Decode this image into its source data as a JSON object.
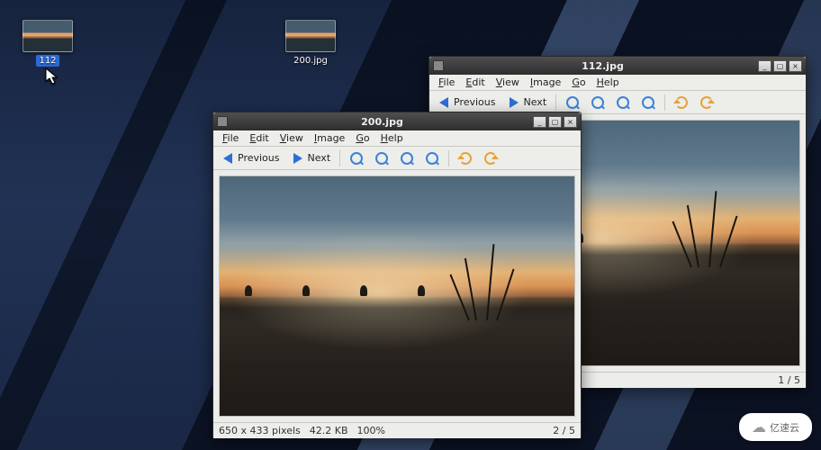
{
  "desktop": {
    "icons": [
      {
        "label": "112",
        "selected": true
      },
      {
        "label": "200.jpg",
        "selected": false
      }
    ]
  },
  "menus": {
    "file": "File",
    "edit": "Edit",
    "view": "View",
    "image": "Image",
    "go": "Go",
    "help": "Help"
  },
  "toolbar": {
    "previous": "Previous",
    "next": "Next"
  },
  "windowA": {
    "title": "112.jpg",
    "status": {
      "counter": "1 / 5"
    }
  },
  "windowB": {
    "title": "200.jpg",
    "status": {
      "dimensions": "650 x 433 pixels",
      "filesize": "42.2 KB",
      "zoom": "100%",
      "counter": "2 / 5"
    }
  },
  "watermark": "亿速云"
}
